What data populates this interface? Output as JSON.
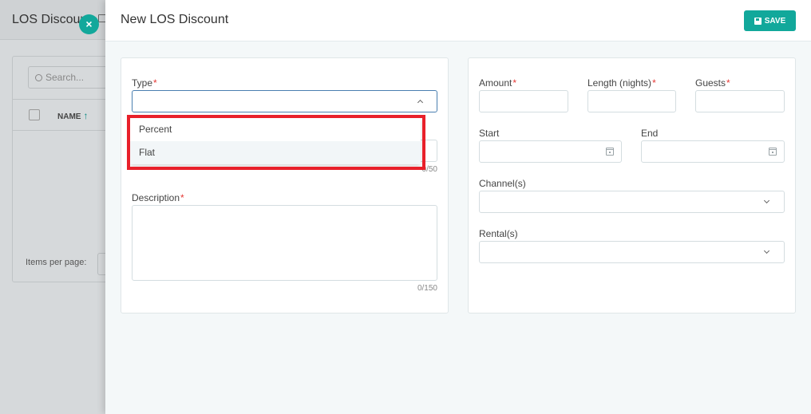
{
  "background": {
    "title": "LOS Discoun",
    "search_placeholder": "Search...",
    "column_name": "NAME",
    "sort_arrow": "↑",
    "items_per_page_label": "Items per page:"
  },
  "drawer": {
    "title": "New LOS Discount",
    "save_label": "SAVE",
    "close_symbol": "×"
  },
  "left_form": {
    "type_label": "Type",
    "type_value": "",
    "type_options": [
      "Percent",
      "Flat"
    ],
    "name_counter": "0/50",
    "description_label": "Description",
    "description_value": "",
    "description_counter": "0/150"
  },
  "right_form": {
    "amount_label": "Amount",
    "length_label": "Length (nights)",
    "guests_label": "Guests",
    "start_label": "Start",
    "end_label": "End",
    "channels_label": "Channel(s)",
    "rentals_label": "Rental(s)"
  },
  "required_mark": "*",
  "colors": {
    "accent": "#12a89b",
    "required": "#e53935",
    "highlight": "#e8202a"
  }
}
